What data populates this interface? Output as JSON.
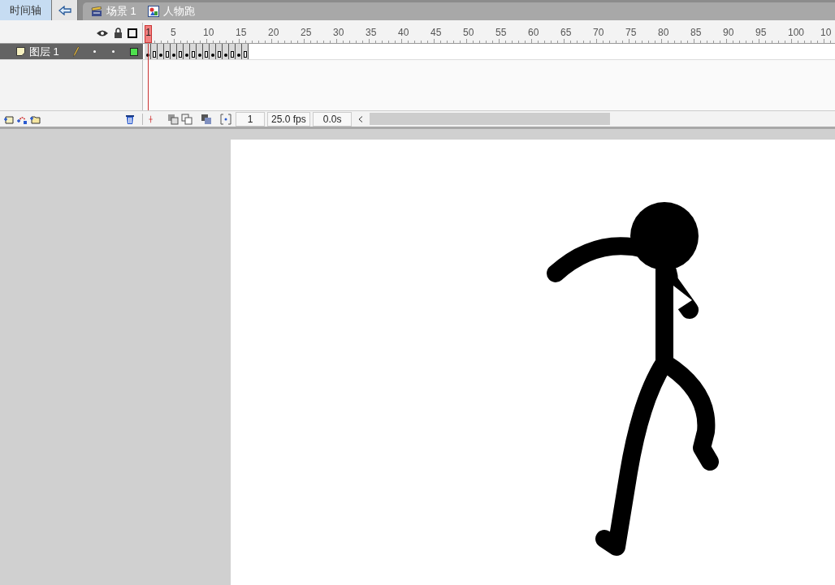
{
  "toolbar": {
    "timeline_button": {
      "label": "时间轴",
      "selected": true
    },
    "breadcrumbs": [
      {
        "label": "场景 1",
        "kind": "scene"
      },
      {
        "label": "人物跑",
        "kind": "symbol"
      }
    ]
  },
  "timeline": {
    "ruler": [
      "1",
      "5",
      "10",
      "15",
      "20",
      "25",
      "30",
      "35",
      "40",
      "45",
      "50",
      "55",
      "60",
      "65",
      "70",
      "75",
      "80",
      "85",
      "90",
      "95",
      "100",
      "10"
    ],
    "layers": [
      {
        "name": "图层 1",
        "selected": true,
        "frames": [
          {
            "kind": "keyframe"
          },
          {
            "kind": "end"
          },
          {
            "kind": "keyframe"
          },
          {
            "kind": "end"
          },
          {
            "kind": "keyframe"
          },
          {
            "kind": "end"
          },
          {
            "kind": "keyframe"
          },
          {
            "kind": "end"
          },
          {
            "kind": "keyframe"
          },
          {
            "kind": "end"
          },
          {
            "kind": "keyframe"
          },
          {
            "kind": "end"
          },
          {
            "kind": "keyframe"
          },
          {
            "kind": "end"
          },
          {
            "kind": "keyframe"
          },
          {
            "kind": "end"
          }
        ]
      }
    ],
    "status": {
      "frame": "1",
      "fps": "25.0 fps",
      "time": "0.0s"
    }
  }
}
